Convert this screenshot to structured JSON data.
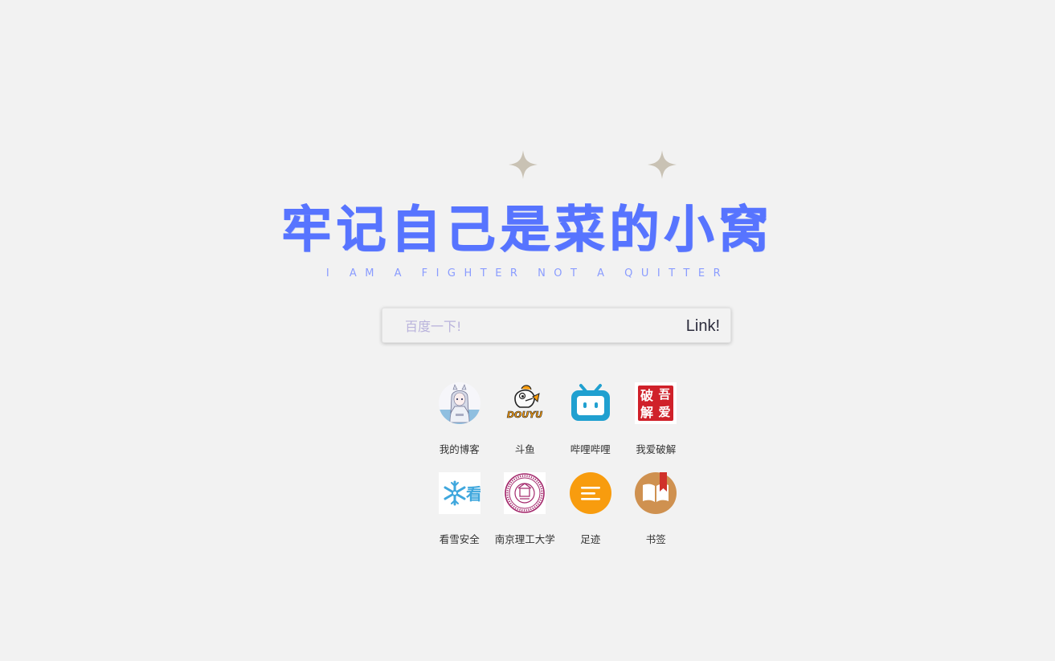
{
  "header": {
    "title": "牢记自己是菜的小窝",
    "subtitle": "I AM A FIGHTER NOT A QUITTER"
  },
  "search": {
    "placeholder": "百度一下!",
    "value": "",
    "button_label": "Link!"
  },
  "shortcuts": [
    {
      "label": "我的博客",
      "icon": "anime-avatar-icon"
    },
    {
      "label": "斗鱼",
      "icon": "douyu-icon",
      "icon_text": "DOUYU"
    },
    {
      "label": "哔哩哔哩",
      "icon": "bilibili-icon"
    },
    {
      "label": "我爱破解",
      "icon": "52pojie-icon",
      "icon_text": [
        "破",
        "吾",
        "解",
        "爱"
      ]
    },
    {
      "label": "看雪安全",
      "icon": "kanxue-icon",
      "icon_text": "看"
    },
    {
      "label": "南京理工大学",
      "icon": "njust-seal-icon"
    },
    {
      "label": "足迹",
      "icon": "footprint-icon"
    },
    {
      "label": "书签",
      "icon": "bookmark-icon"
    }
  ],
  "colors": {
    "background": "#f2f2f2",
    "title": "#5774ff",
    "subtitle": "#8a9cff",
    "sparkle": "#c9c2b4",
    "bilibili": "#20a0d0",
    "pojie_red": "#d0212a",
    "footprint_orange": "#f89c0e",
    "bookmark_brown": "#cf9150"
  }
}
